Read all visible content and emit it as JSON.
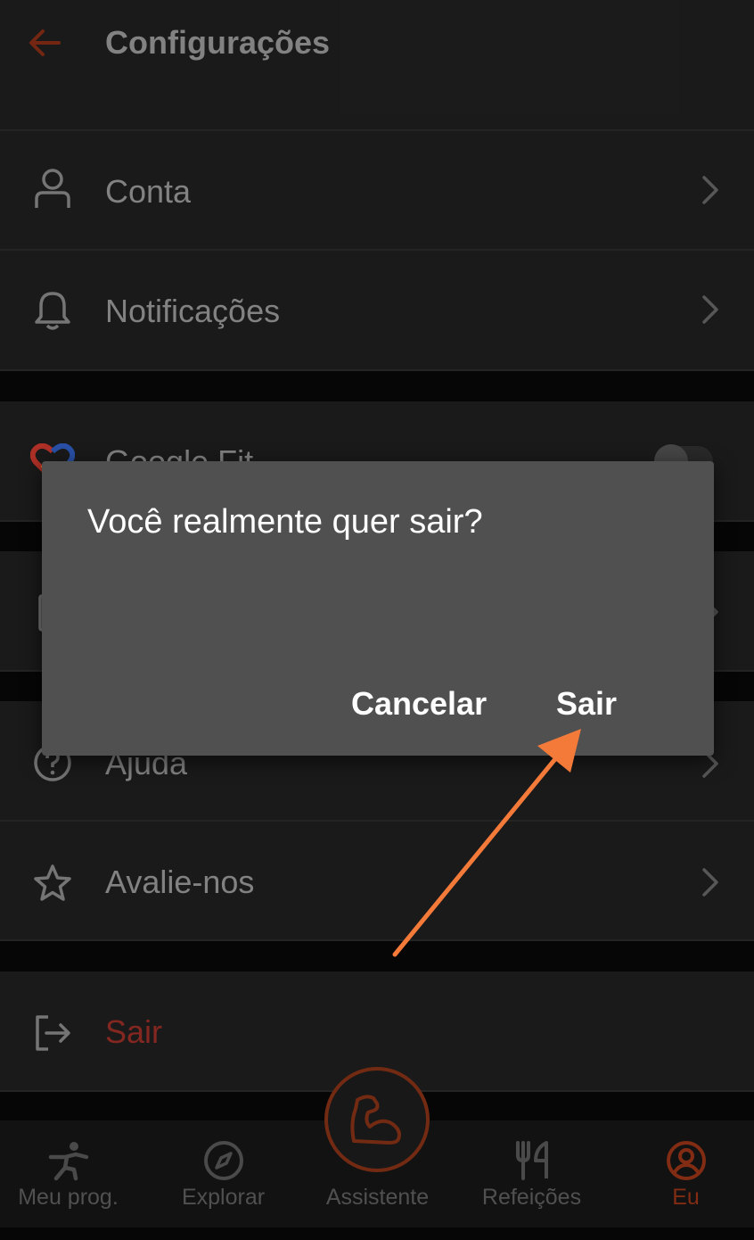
{
  "header": {
    "title": "Configurações",
    "back_icon": "arrow-left-icon"
  },
  "settings": {
    "account": {
      "label": "Conta",
      "icon": "user-icon"
    },
    "notifications": {
      "label": "Notificações",
      "icon": "bell-icon"
    },
    "google_fit": {
      "label": "Google Fit",
      "icon": "google-fit-heart-icon",
      "enabled": false
    },
    "help": {
      "label": "Ajuda",
      "icon": "help-circle-icon"
    },
    "rate": {
      "label": "Avalie-nos",
      "icon": "star-icon"
    },
    "logout": {
      "label": "Sair",
      "icon": "logout-icon"
    }
  },
  "bottom_nav": {
    "items": [
      {
        "label": "Meu prog.",
        "icon": "exercise-person-icon"
      },
      {
        "label": "Explorar",
        "icon": "compass-icon"
      },
      {
        "label": "Assistente",
        "icon": "flexed-arm-icon"
      },
      {
        "label": "Refeições",
        "icon": "fork-knife-icon"
      },
      {
        "label": "Eu",
        "icon": "profile-circle-icon"
      }
    ],
    "active_index": 4
  },
  "dialog": {
    "title": "Você realmente quer sair?",
    "cancel_label": "Cancelar",
    "confirm_label": "Sair"
  },
  "colors": {
    "accent": "#c8401f",
    "logout_text": "#8c2a22",
    "annotation_arrow": "#f47a3a",
    "dialog_bg": "#505050"
  }
}
